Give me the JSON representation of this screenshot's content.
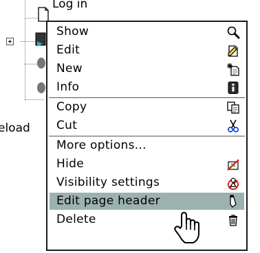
{
  "tree": {
    "node_top_label": "Log in",
    "partial_left_label": "eload"
  },
  "menu": {
    "items": [
      {
        "label": "Show",
        "icon": "magnifier-icon"
      },
      {
        "label": "Edit",
        "icon": "edit-icon"
      },
      {
        "label": "New",
        "icon": "new-page-icon"
      },
      {
        "label": "Info",
        "icon": "info-icon"
      },
      {
        "label": "Copy",
        "icon": "copy-icon"
      },
      {
        "label": "Cut",
        "icon": "scissors-icon"
      },
      {
        "label": "More options...",
        "icon": ""
      },
      {
        "label": "Hide",
        "icon": "hide-icon"
      },
      {
        "label": "Visibility settings",
        "icon": "visibility-settings-icon"
      },
      {
        "label": "Edit page header",
        "icon": "pencil-icon"
      },
      {
        "label": "Delete",
        "icon": "trash-icon"
      }
    ],
    "highlighted_item": "Edit page header"
  },
  "colors": {
    "highlight": "#9cb2b0",
    "border": "#1a1a1a"
  }
}
